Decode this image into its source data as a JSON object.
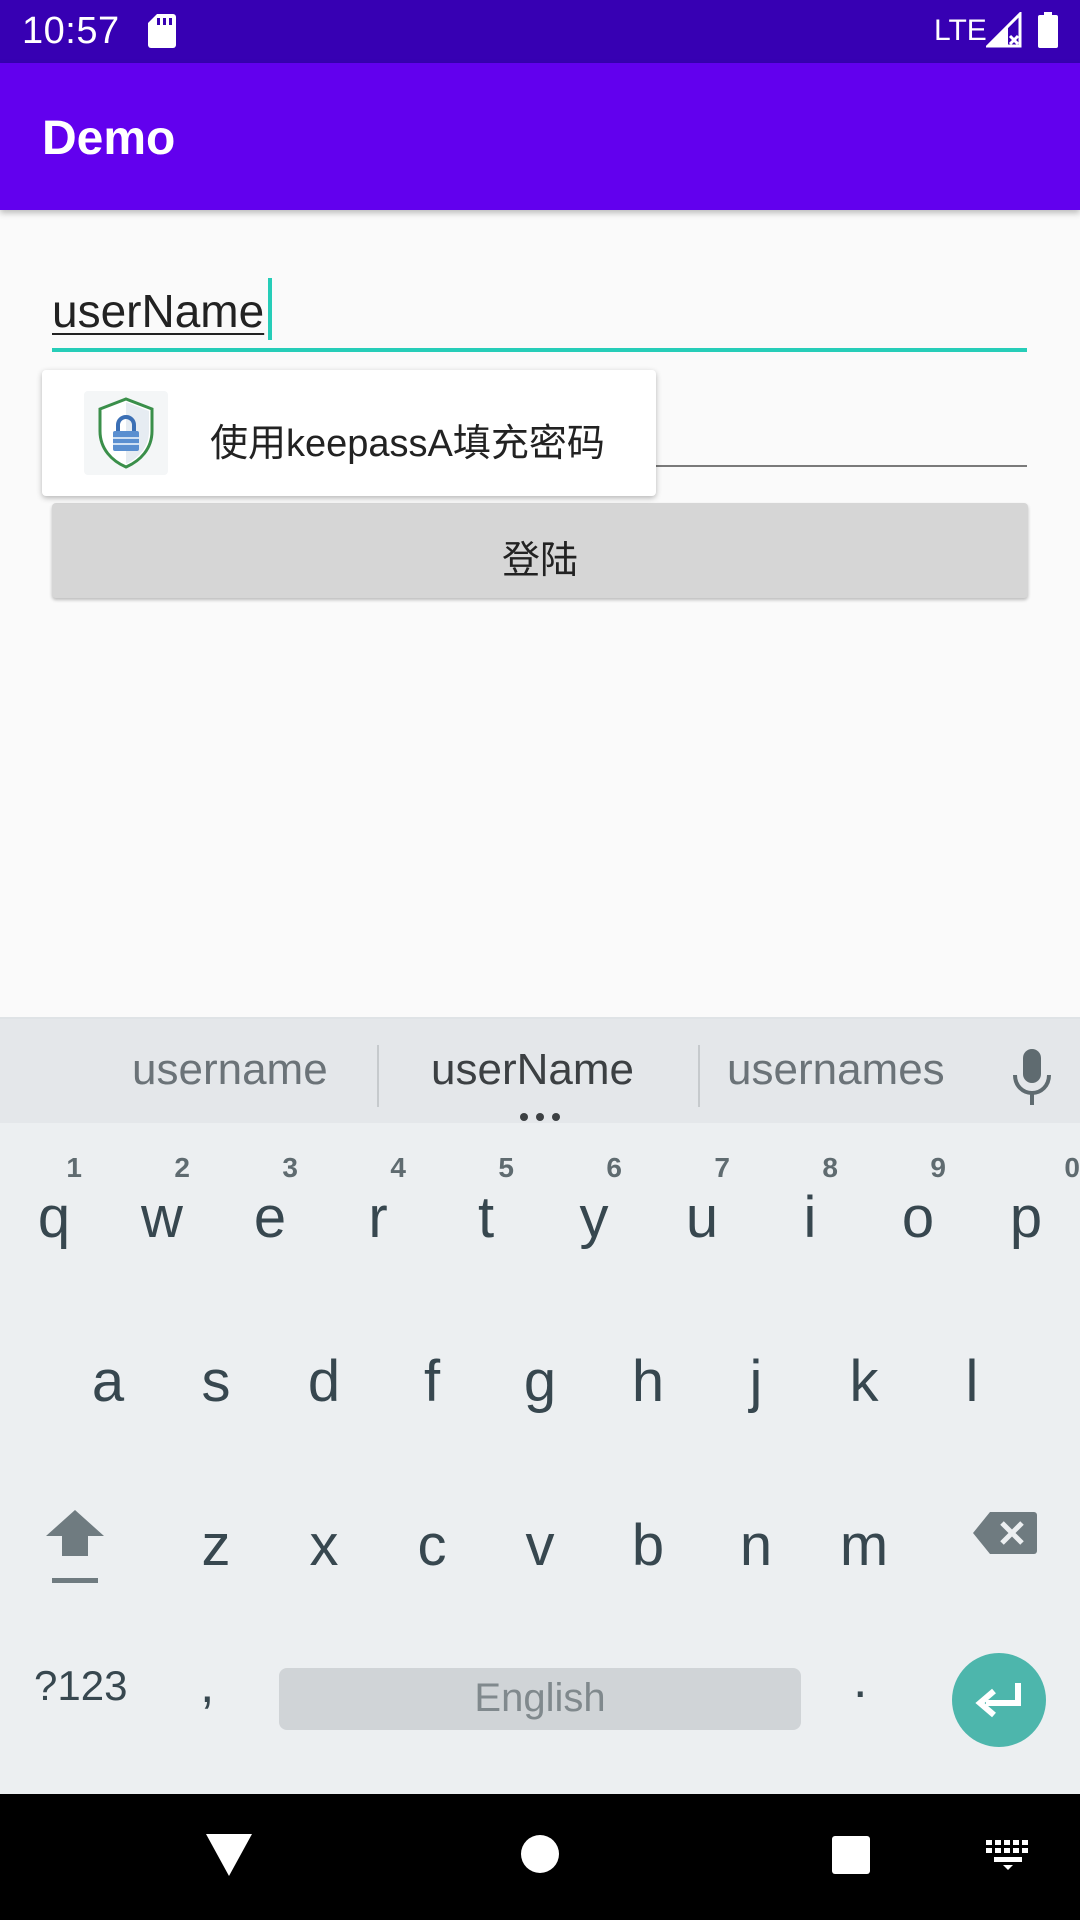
{
  "status_bar": {
    "time": "10:57",
    "network": "LTE",
    "icons": [
      "sd-card-icon",
      "signal-icon",
      "battery-icon"
    ]
  },
  "app_bar": {
    "title": "Demo"
  },
  "form": {
    "username_value": "userName",
    "password_value": "",
    "login_label": "登陆"
  },
  "autofill": {
    "label": "使用keepassA填充密码",
    "icon": "keepass-shield-lock-icon"
  },
  "keyboard": {
    "suggestions": [
      "username",
      "userName",
      "usernames"
    ],
    "row1": [
      {
        "key": "q",
        "hint": "1"
      },
      {
        "key": "w",
        "hint": "2"
      },
      {
        "key": "e",
        "hint": "3"
      },
      {
        "key": "r",
        "hint": "4"
      },
      {
        "key": "t",
        "hint": "5"
      },
      {
        "key": "y",
        "hint": "6"
      },
      {
        "key": "u",
        "hint": "7"
      },
      {
        "key": "i",
        "hint": "8"
      },
      {
        "key": "o",
        "hint": "9"
      },
      {
        "key": "p",
        "hint": "0"
      }
    ],
    "row2": [
      "a",
      "s",
      "d",
      "f",
      "g",
      "h",
      "j",
      "k",
      "l"
    ],
    "row3": [
      "z",
      "x",
      "c",
      "v",
      "b",
      "n",
      "m"
    ],
    "symbols_label": "?123",
    "comma": ",",
    "space_label": "English",
    "period": "."
  },
  "colors": {
    "status_bar": "#3700b3",
    "app_bar": "#6200ee",
    "accent": "#26cdb8",
    "enter_key": "#4db6ac"
  }
}
